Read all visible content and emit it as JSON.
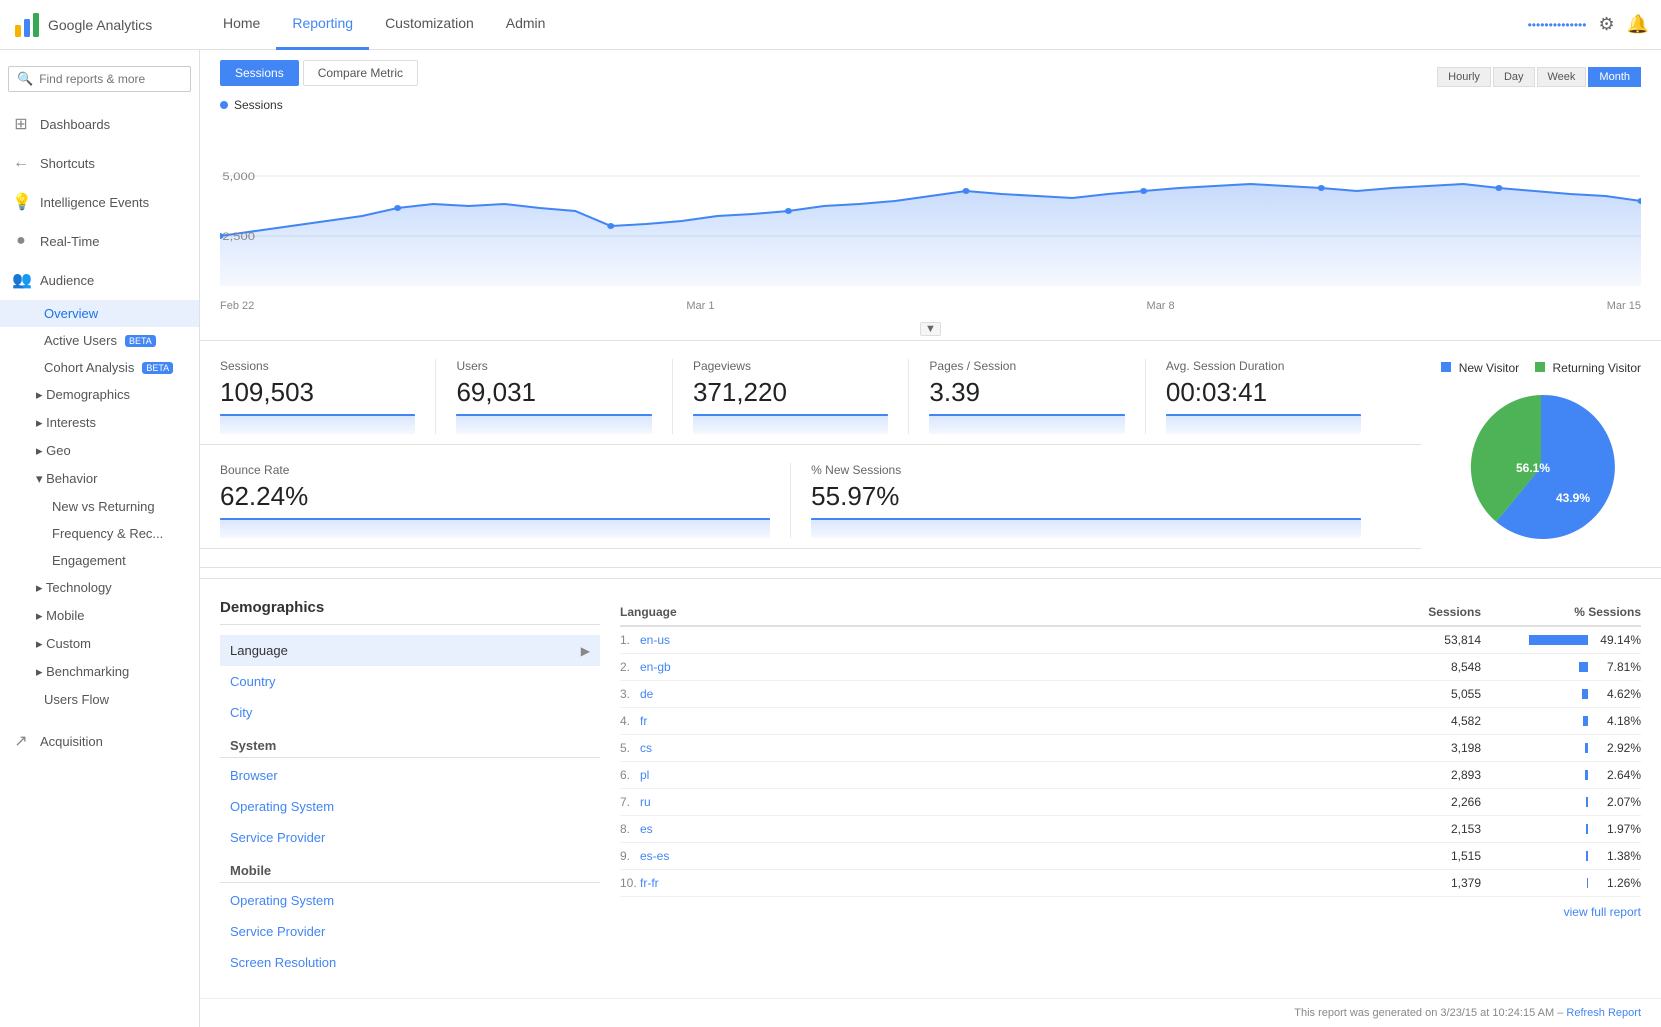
{
  "nav": {
    "logo_text": "Google Analytics",
    "links": [
      "Home",
      "Reporting",
      "Customization",
      "Admin"
    ],
    "active_link": "Reporting",
    "account_name": "••••••••••••••",
    "time_buttons": [
      "Hourly",
      "Day",
      "Week",
      "Month"
    ]
  },
  "sidebar": {
    "search_placeholder": "Find reports & more",
    "items": [
      {
        "label": "Dashboards",
        "icon": "⊞"
      },
      {
        "label": "Shortcuts",
        "icon": "←"
      },
      {
        "label": "Intelligence Events",
        "icon": "💡"
      },
      {
        "label": "Real-Time",
        "icon": "●"
      },
      {
        "label": "Audience",
        "icon": "👥"
      }
    ],
    "audience_sub": [
      {
        "label": "Overview",
        "active": true
      },
      {
        "label": "Active Users",
        "badge": "BETA"
      },
      {
        "label": "Cohort Analysis",
        "badge": "BETA"
      },
      {
        "label": "▸ Demographics"
      },
      {
        "label": "▸ Interests"
      },
      {
        "label": "▸ Geo"
      },
      {
        "label": "▾ Behavior"
      },
      {
        "label": "New vs Returning",
        "indent": true
      },
      {
        "label": "Frequency & Rec...",
        "indent": true
      },
      {
        "label": "Engagement",
        "indent": true
      },
      {
        "label": "▸ Technology"
      },
      {
        "label": "▸ Mobile"
      },
      {
        "label": "▸ Custom"
      },
      {
        "label": "▸ Benchmarking"
      },
      {
        "label": "Users Flow"
      }
    ],
    "acquisition": {
      "label": "Acquisition",
      "icon": "↗"
    }
  },
  "chart": {
    "tabs": [
      "Sessions",
      "Compare Metric"
    ],
    "active_tab": "Sessions",
    "y_labels": [
      "5,000",
      "2,500"
    ],
    "x_labels": [
      "Feb 22",
      "Mar 1",
      "Mar 8",
      "Mar 15"
    ],
    "sessions_label": "Sessions"
  },
  "metrics": [
    {
      "label": "Sessions",
      "value": "109,503"
    },
    {
      "label": "Users",
      "value": "69,031"
    },
    {
      "label": "Pageviews",
      "value": "371,220"
    },
    {
      "label": "Pages / Session",
      "value": "3.39"
    },
    {
      "label": "Avg. Session Duration",
      "value": "00:03:41"
    }
  ],
  "metrics2": [
    {
      "label": "Bounce Rate",
      "value": "62.24%"
    },
    {
      "label": "% New Sessions",
      "value": "55.97%"
    }
  ],
  "pie": {
    "new_visitor_label": "New Visitor",
    "returning_visitor_label": "Returning Visitor",
    "new_pct": 56.1,
    "returning_pct": 43.9,
    "new_label": "56.1%",
    "returning_label": "43.9%",
    "new_color": "#4285f4",
    "returning_color": "#4db356"
  },
  "demographics": {
    "title": "Demographics",
    "groups": [
      {
        "label": "",
        "items": [
          {
            "label": "Language",
            "selected": true,
            "arrow": true
          },
          {
            "label": "Country"
          },
          {
            "label": "City"
          }
        ]
      },
      {
        "label": "System",
        "items": [
          {
            "label": "Browser"
          },
          {
            "label": "Operating System"
          },
          {
            "label": "Service Provider"
          }
        ]
      },
      {
        "label": "Mobile",
        "items": [
          {
            "label": "Operating System"
          },
          {
            "label": "Service Provider"
          },
          {
            "label": "Screen Resolution"
          }
        ]
      }
    ]
  },
  "table": {
    "header": {
      "language": "Language",
      "sessions": "Sessions",
      "pct_sessions": "% Sessions"
    },
    "rows": [
      {
        "num": "1.",
        "lang": "en-us",
        "sessions": "53,814",
        "pct": "49.14%",
        "bar_pct": 49.14
      },
      {
        "num": "2.",
        "lang": "en-gb",
        "sessions": "8,548",
        "pct": "7.81%",
        "bar_pct": 7.81
      },
      {
        "num": "3.",
        "lang": "de",
        "sessions": "5,055",
        "pct": "4.62%",
        "bar_pct": 4.62
      },
      {
        "num": "4.",
        "lang": "fr",
        "sessions": "4,582",
        "pct": "4.18%",
        "bar_pct": 4.18
      },
      {
        "num": "5.",
        "lang": "cs",
        "sessions": "3,198",
        "pct": "2.92%",
        "bar_pct": 2.92
      },
      {
        "num": "6.",
        "lang": "pl",
        "sessions": "2,893",
        "pct": "2.64%",
        "bar_pct": 2.64
      },
      {
        "num": "7.",
        "lang": "ru",
        "sessions": "2,266",
        "pct": "2.07%",
        "bar_pct": 2.07
      },
      {
        "num": "8.",
        "lang": "es",
        "sessions": "2,153",
        "pct": "1.97%",
        "bar_pct": 1.97
      },
      {
        "num": "9.",
        "lang": "es-es",
        "sessions": "1,515",
        "pct": "1.38%",
        "bar_pct": 1.38
      },
      {
        "num": "10.",
        "lang": "fr-fr",
        "sessions": "1,379",
        "pct": "1.26%",
        "bar_pct": 1.26
      }
    ],
    "view_full_report": "view full report"
  },
  "footer": {
    "report_generated": "This report was generated on 3/23/15 at 10:24:15 AM –",
    "refresh_label": "Refresh Report"
  }
}
